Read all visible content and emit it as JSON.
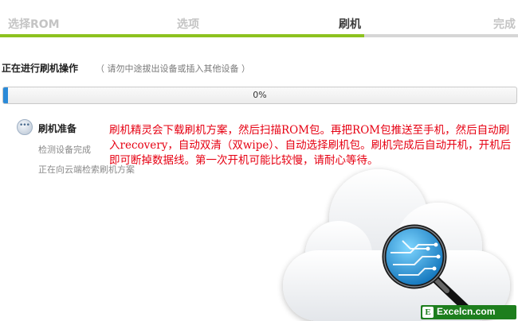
{
  "steps": {
    "items": [
      {
        "label": "选择ROM"
      },
      {
        "label": "选项"
      },
      {
        "label": "刷机"
      },
      {
        "label": "完成"
      }
    ],
    "active_index": 2,
    "accent_color": "#8dc21f"
  },
  "status": {
    "heading": "正在进行刷机操作",
    "note": "（ 请勿中途拔出设备或插入其他设备 ）"
  },
  "progress": {
    "value": 0,
    "label": "0%",
    "color": "#2a8ad8"
  },
  "task": {
    "icon": "ellipsis-icon",
    "title": "刷机准备",
    "sub1": "检测设备完成",
    "sub2": "正在向云端检索刷机方案"
  },
  "overlay_text": "刷机精灵会下载刷机方案，然后扫描ROM包。再把ROM包推送至手机，然后自动刷入recovery，自动双清（双wipe）、自动选择刷机包。刷机完成后自动开机，开机后即可断掉数据线。第一次开机可能比较慢，请耐心等待。",
  "illustration": {
    "cloud": "cloud-icon",
    "magnifier": "magnifier-icon"
  },
  "watermark": {
    "logo": "E",
    "text": "Excelcn.com"
  }
}
